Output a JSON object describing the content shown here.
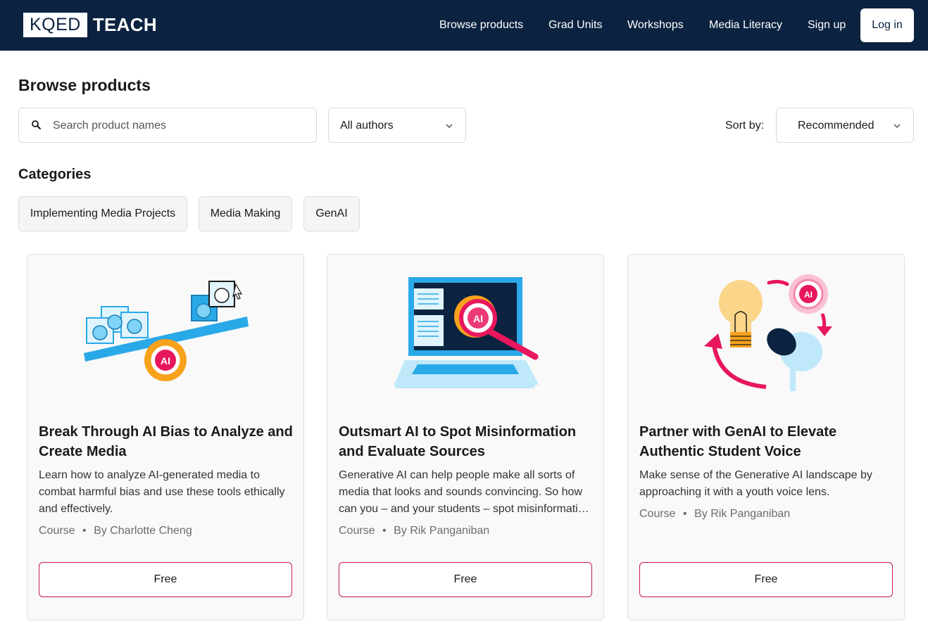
{
  "header": {
    "logo_left": "KQED",
    "logo_right": "TEACH",
    "nav": [
      "Browse products",
      "Grad Units",
      "Workshops",
      "Media Literacy",
      "Sign up"
    ],
    "login_label": "Log in"
  },
  "page": {
    "title": "Browse products"
  },
  "filters": {
    "search_placeholder": "Search product names",
    "authors_value": "All authors",
    "sort_label": "Sort by:",
    "sort_value": "Recommended"
  },
  "categories": {
    "title": "Categories",
    "items": [
      "Implementing Media Projects",
      "Media Making",
      "GenAI"
    ]
  },
  "cards": [
    {
      "title": "Break Through AI Bias to Analyze and Create Media",
      "description": "Learn how to analyze AI-generated media to combat harmful bias and use these tools ethically and effectively.",
      "type": "Course",
      "author": "By Charlotte Cheng",
      "price": "Free",
      "image_label": "AI"
    },
    {
      "title": "Outsmart AI to Spot Misinformation and Evaluate Sources",
      "description": "Generative AI can help people make all sorts of media that looks and sounds convincing. So how can you – and your students – spot misinformation and evaluate sources?",
      "type": "Course",
      "author": "By Rik Panganiban",
      "price": "Free",
      "image_label": "AI"
    },
    {
      "title": "Partner with GenAI to Elevate Authentic Student Voice",
      "description": "Make sense of the Generative AI landscape by approaching it with a youth voice lens.",
      "type": "Course",
      "author": "By Rik Panganiban",
      "price": "Free",
      "image_label": "AI"
    }
  ],
  "colors": {
    "header_bg": "#0b2340",
    "accent": "#c8175d",
    "illustration_blue": "#29a9e8",
    "illustration_orange": "#f7a21b",
    "illustration_pink": "#e8175d"
  }
}
